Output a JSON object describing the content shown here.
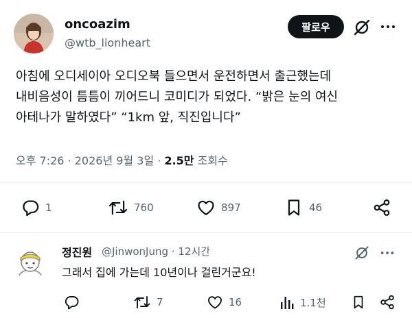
{
  "tweet": {
    "display_name": "oncoazim",
    "handle": "@wtb_lionheart",
    "follow_label": "팔로우",
    "text_lines": [
      "아침에 오디세이아 오디오북 들으면서 운전하면서 출근했는데",
      "내비음성이 틈틈이 끼어드니 코미디가 되었다. “밝은 눈의 여신",
      "아테나가 말하였다” “1km 앞, 직진입니다”"
    ],
    "time": "오후 7:26",
    "sep": "·",
    "date": "2026년 9월 3일",
    "views_count": "2.5만",
    "views_label": "조회수",
    "actions": {
      "replies": "1",
      "retweets": "760",
      "likes": "897",
      "bookmarks": "46"
    }
  },
  "reply": {
    "display_name": "정진원",
    "handle": "@JinwonJung",
    "sep": "·",
    "time": "12시간",
    "text": "그래서 집에 가는데 10년이나 걸린거군요!",
    "actions": {
      "retweets": "7",
      "likes": "16",
      "views": "1.1천"
    }
  },
  "icons": {
    "reply": "speech-bubble-icon",
    "retweet": "retweet-icon",
    "like": "heart-icon",
    "bookmark": "bookmark-icon",
    "share": "share-icon",
    "grok": "grok-icon",
    "more": "more-icon",
    "views": "bar-chart-icon"
  },
  "colors": {
    "text": "#0f1419",
    "secondary": "#536471",
    "follow_bg": "#0f1419",
    "divider": "#eff3f4"
  }
}
